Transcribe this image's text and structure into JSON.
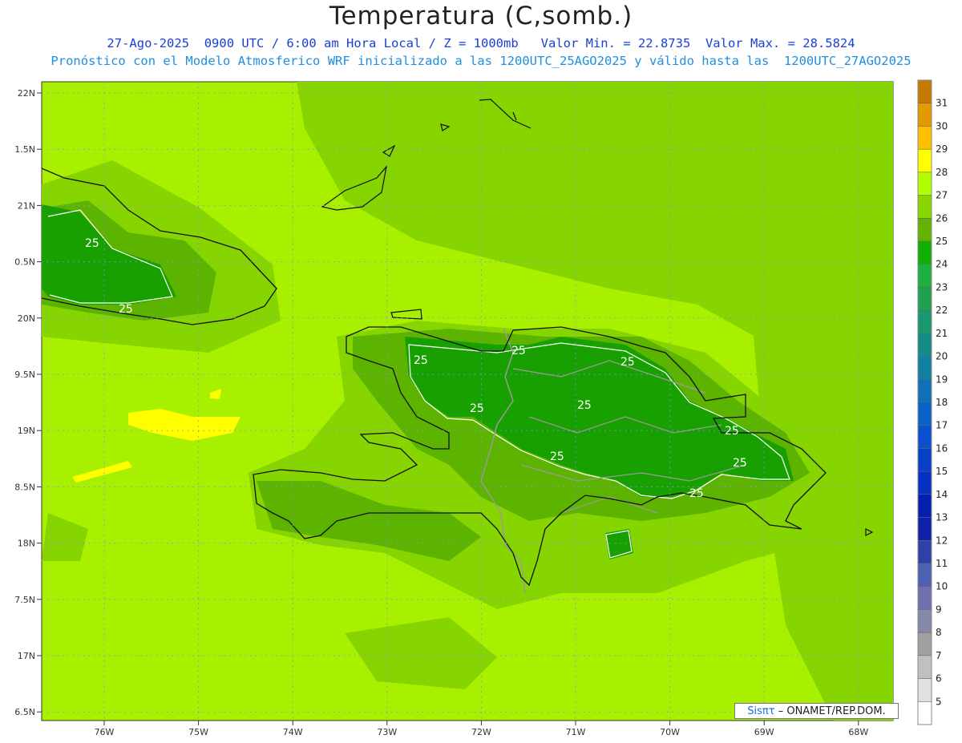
{
  "title": "Temperatura (C,somb.)",
  "subtitle_1": "27-Ago-2025  0900 UTC / 6:00 am Hora Local / Z = 1000mb   Valor Min. = 22.8735  Valor Max. = 28.5824",
  "subtitle_2": "Pronóstico con el Modelo Atmosferico WRF inicializado a las 1200UTC_25AGO2025 y válido hasta las  1200UTC_27AGO2025",
  "latitude_ticks": [
    "22N",
    "1.5N",
    "21N",
    "0.5N",
    "20N",
    "9.5N",
    "19N",
    "8.5N",
    "18N",
    "7.5N",
    "17N",
    "6.5N"
  ],
  "longitude_ticks": [
    "76W",
    "75W",
    "74W",
    "73W",
    "72W",
    "71W",
    "70W",
    "69W",
    "68W"
  ],
  "colorbar": {
    "labels": [
      "31",
      "30",
      "29",
      "28",
      "27",
      "26",
      "25",
      "24",
      "23",
      "22",
      "21",
      "20",
      "19",
      "18",
      "17",
      "16",
      "15",
      "14",
      "13",
      "12",
      "11",
      "10",
      "9",
      "8",
      "7",
      "6",
      "5"
    ],
    "colors": [
      "#c47a00",
      "#e39a00",
      "#ffc000",
      "#ffff00",
      "#b2ff00",
      "#8ad600",
      "#62b400",
      "#10b000",
      "#20b040",
      "#20a050",
      "#1a9870",
      "#168c88",
      "#1280a0",
      "#1070b8",
      "#0c60c8",
      "#0a50d0",
      "#0840c8",
      "#0630c0",
      "#0420b0",
      "#1020a8",
      "#3040a8",
      "#5060b0",
      "#7070b0",
      "#8888aa",
      "#a0a0a0",
      "#c0c0c0",
      "#e0e0e0",
      "#ffffff"
    ]
  },
  "contour_labels": [
    "25",
    "25",
    "25",
    "25",
    "25",
    "25",
    "25",
    "25",
    "25",
    "25",
    "25"
  ],
  "credit": {
    "brand": "Sisπτ",
    "text": "– ONAMET/REP.DOM."
  },
  "colors": {
    "sea": "#a8f000",
    "land_light": "#86d400",
    "land_mid": "#5cb400",
    "land_dark": "#18a000",
    "coast": "#111111",
    "borders": "#9a9a9a",
    "grid": "#8a8aff"
  }
}
